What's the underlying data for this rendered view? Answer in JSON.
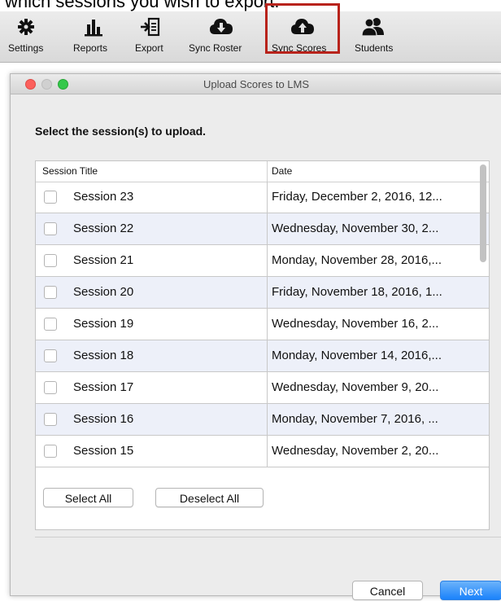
{
  "page_caption": "which sessions you wish to export.",
  "toolbar": {
    "items": [
      {
        "label": "Settings",
        "icon": "gear-icon"
      },
      {
        "label": "Reports",
        "icon": "bar-chart-icon"
      },
      {
        "label": "Export",
        "icon": "export-icon"
      },
      {
        "label": "Sync Roster",
        "icon": "cloud-download-icon"
      },
      {
        "label": "Sync Scores",
        "icon": "cloud-upload-icon"
      },
      {
        "label": "Students",
        "icon": "students-icon"
      }
    ],
    "highlight_color": "#b8231b"
  },
  "window": {
    "title": "Upload Scores to LMS",
    "prompt": "Select the session(s) to upload.",
    "table": {
      "headers": [
        "Session Title",
        "Date"
      ],
      "rows": [
        {
          "title": "Session 23",
          "date": "Friday, December 2, 2016, 12..."
        },
        {
          "title": "Session 22",
          "date": "Wednesday, November 30, 2..."
        },
        {
          "title": "Session 21",
          "date": "Monday, November 28, 2016,..."
        },
        {
          "title": "Session 20",
          "date": "Friday, November 18, 2016, 1..."
        },
        {
          "title": "Session 19",
          "date": "Wednesday, November 16, 2..."
        },
        {
          "title": "Session 18",
          "date": "Monday, November 14, 2016,..."
        },
        {
          "title": "Session 17",
          "date": "Wednesday, November 9, 20..."
        },
        {
          "title": "Session 16",
          "date": "Monday, November 7, 2016, ..."
        },
        {
          "title": "Session 15",
          "date": "Wednesday, November 2, 20..."
        }
      ]
    },
    "buttons": {
      "select_all": "Select All",
      "deselect_all": "Deselect All",
      "cancel": "Cancel",
      "next": "Next"
    },
    "colors": {
      "row_alt": "#edf0f9",
      "primary_button": "#1a82fb"
    }
  }
}
